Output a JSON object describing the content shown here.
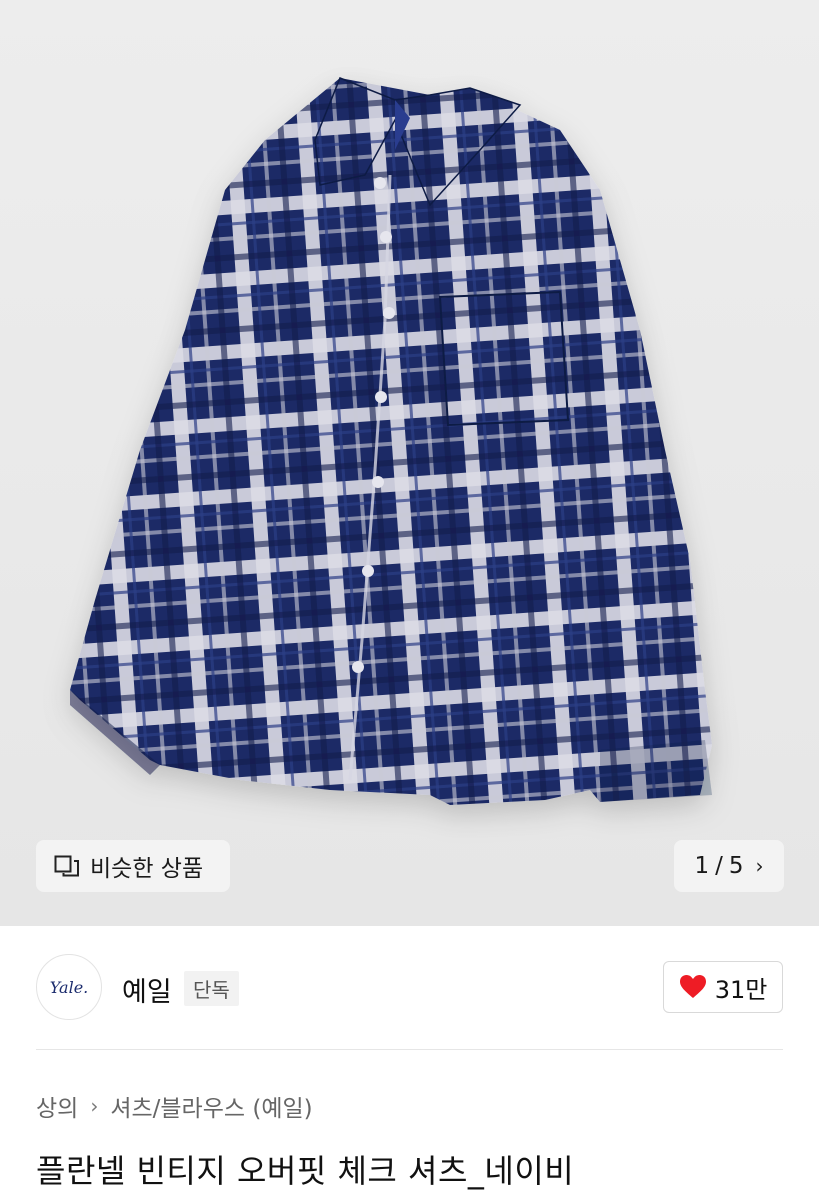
{
  "gallery": {
    "similar_label": "비슷한 상품",
    "current_page": "1",
    "page_separator": "/",
    "total_pages": "5"
  },
  "brand": {
    "logo_text": "Yale.",
    "name": "예일",
    "badge": "단독"
  },
  "likes": {
    "count": "31만"
  },
  "breadcrumb": {
    "category": "상의",
    "subcategory": "셔츠/블라우스 (예일)"
  },
  "product": {
    "title": "플란넬 빈티지 오버핏 체크 셔츠_네이비"
  },
  "colors": {
    "shirt_navy": "#1b2a66",
    "shirt_check_white": "#e8e8ee",
    "heart_red": "#ee1c25",
    "hero_bg": "#ececec"
  }
}
